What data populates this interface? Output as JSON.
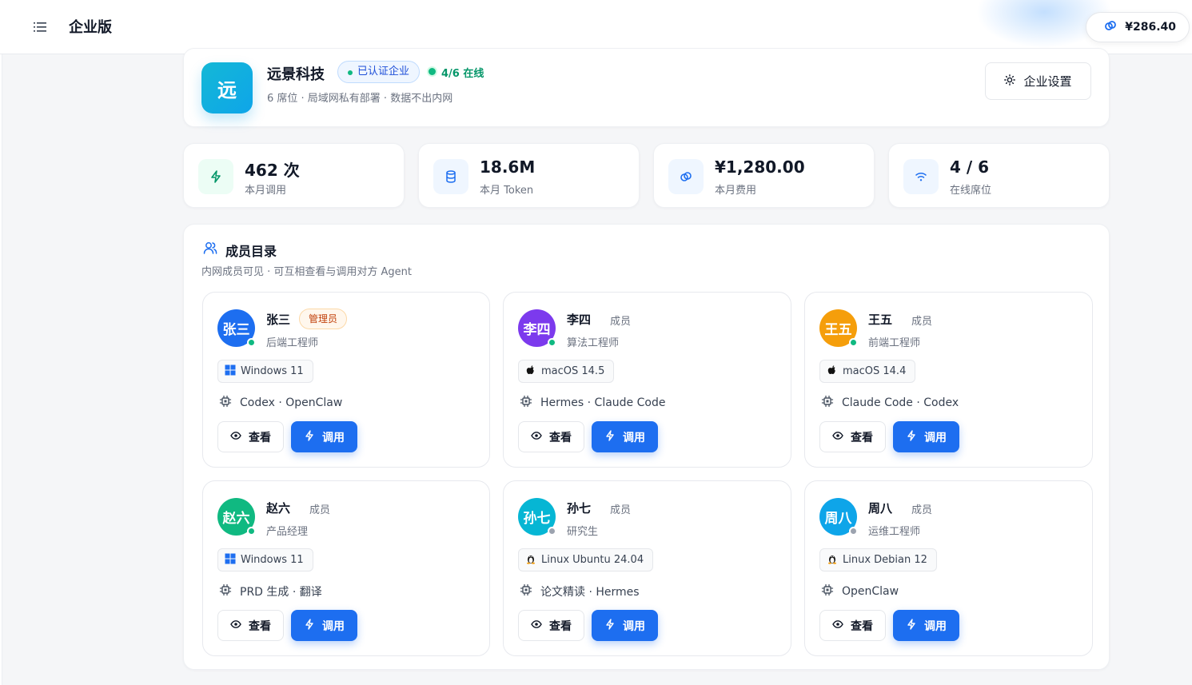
{
  "header": {
    "title": "企业版",
    "balance": "¥286.40"
  },
  "company": {
    "logo_char": "远",
    "name": "远景科技",
    "verified_label": "已认证企业",
    "online_label": "4/6 在线",
    "subtitle": "6 席位 · 局域网私有部署 · 数据不出内网",
    "settings_label": "企业设置"
  },
  "stats": [
    {
      "value": "462 次",
      "label": "本月调用",
      "icon": "zap-icon"
    },
    {
      "value": "18.6M",
      "label": "本月 Token",
      "icon": "database-icon"
    },
    {
      "value": "¥1,280.00",
      "label": "本月费用",
      "icon": "coins-icon"
    },
    {
      "value": "4 / 6",
      "label": "在线席位",
      "icon": "wifi-icon"
    }
  ],
  "directory": {
    "title": "成员目录",
    "subtitle": "内网成员可见 · 可互相查看与调用对方 Agent"
  },
  "actions": {
    "view_label": "查看",
    "call_label": "调用"
  },
  "members": [
    {
      "avatar": "张三",
      "name": "张三",
      "role": "管理员",
      "is_admin": true,
      "job": "后端工程师",
      "os": "Windows 11",
      "os_icon": "windows-icon",
      "agents": "Codex · OpenClaw",
      "online": true,
      "color": "#1d6ef0"
    },
    {
      "avatar": "李四",
      "name": "李四",
      "role": "成员",
      "is_admin": false,
      "job": "算法工程师",
      "os": "macOS 14.5",
      "os_icon": "apple-icon",
      "agents": "Hermes · Claude Code",
      "online": true,
      "color": "#7c3aed"
    },
    {
      "avatar": "王五",
      "name": "王五",
      "role": "成员",
      "is_admin": false,
      "job": "前端工程师",
      "os": "macOS 14.4",
      "os_icon": "apple-icon",
      "agents": "Claude Code · Codex",
      "online": true,
      "color": "#f59e0b"
    },
    {
      "avatar": "赵六",
      "name": "赵六",
      "role": "成员",
      "is_admin": false,
      "job": "产品经理",
      "os": "Windows 11",
      "os_icon": "windows-icon",
      "agents": "PRD 生成 · 翻译",
      "online": true,
      "color": "#10b981"
    },
    {
      "avatar": "孙七",
      "name": "孙七",
      "role": "成员",
      "is_admin": false,
      "job": "研究生",
      "os": "Linux Ubuntu 24.04",
      "os_icon": "linux-icon",
      "agents": "论文精读 · Hermes",
      "online": false,
      "color": "#06b6d4"
    },
    {
      "avatar": "周八",
      "name": "周八",
      "role": "成员",
      "is_admin": false,
      "job": "运维工程师",
      "os": "Linux Debian 12",
      "os_icon": "linux-icon",
      "agents": "OpenClaw",
      "online": false,
      "color": "#0ea5e9"
    }
  ],
  "colors": {
    "primary": "#1d6ef0",
    "online": "#10b981",
    "offline": "#9ca3af"
  }
}
